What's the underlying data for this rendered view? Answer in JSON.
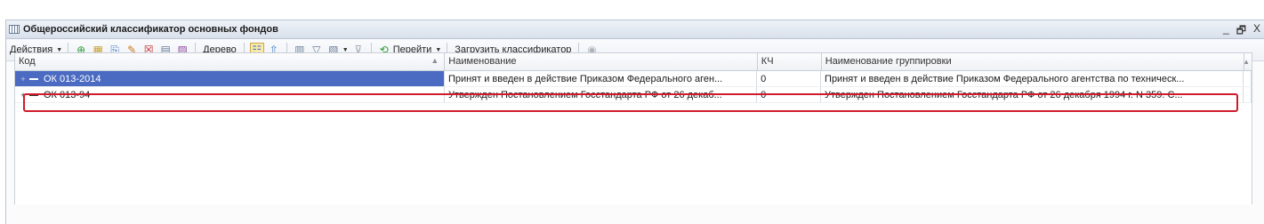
{
  "window": {
    "title": "Общероссийский классификатор основных фондов",
    "minimize": "_",
    "restore": "🗗",
    "close": "X"
  },
  "toolbar": {
    "actions_label": "Действия",
    "tree_label": "Дерево",
    "goto_label": "Перейти",
    "load_label": "Загрузить классификатор"
  },
  "table": {
    "columns": [
      "Код",
      "Наименование",
      "КЧ",
      "Наименование группировки"
    ],
    "rows": [
      {
        "code": "ОК 013-2014",
        "name": "Принят и введен в действие Приказом Федерального аген...",
        "kch": "0",
        "group_name": "Принят и введен в действие Приказом Федерального агентства по техническ..."
      },
      {
        "code": "ОК 013-94",
        "name": "Утвержден Постановлением Госстандарта РФ от 26 декаб...",
        "kch": "0",
        "group_name": "Утвержден Постановлением Госстандарта РФ от 26 декабря 1994 г. N 359.  С..."
      }
    ]
  },
  "colors": {
    "selection": "#4a6bc1",
    "highlight_border": "#d01b2a",
    "pressed_button": "#fbe9a8"
  }
}
